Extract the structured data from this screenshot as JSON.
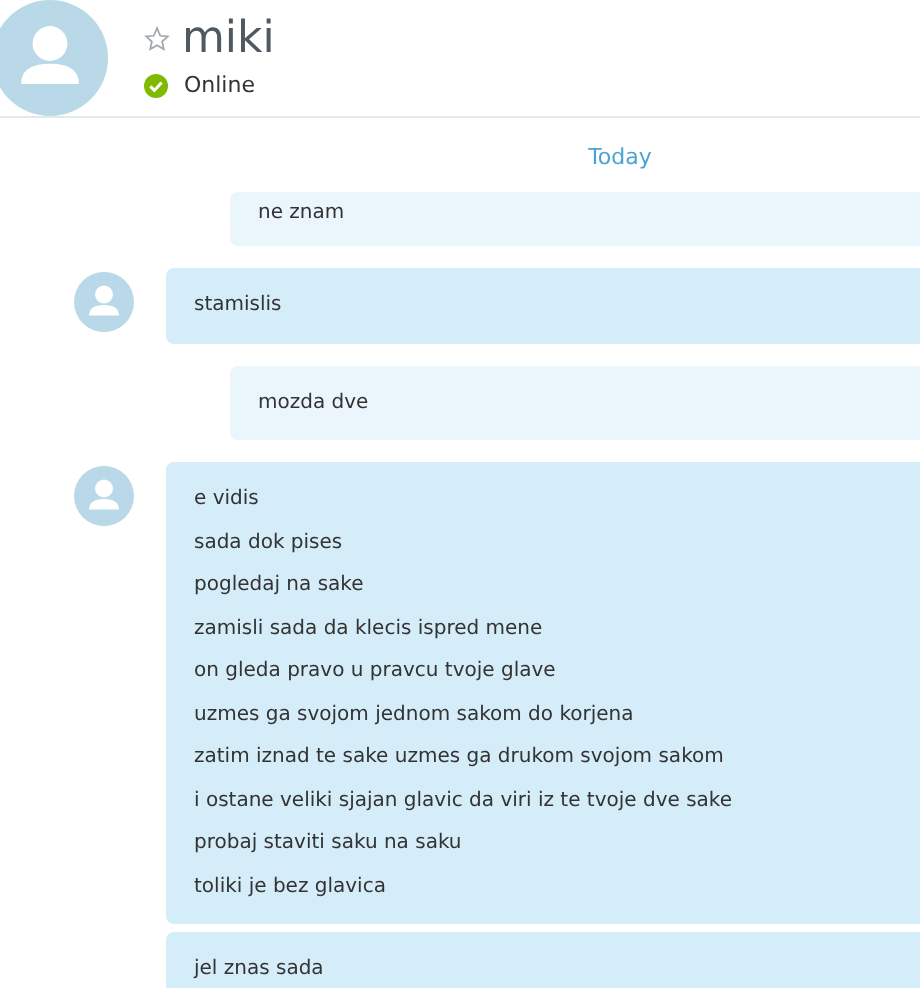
{
  "contact": {
    "name": "miki",
    "favorite": false,
    "status": "Online",
    "online": true
  },
  "day_label": "Today",
  "messages": [
    {
      "kind": "outgoing",
      "avatar": false,
      "lines": [
        "ne znam"
      ]
    },
    {
      "kind": "incoming",
      "avatar": true,
      "lines": [
        "stamislis"
      ]
    },
    {
      "kind": "outgoing",
      "avatar": false,
      "lines": [
        "mozda dve"
      ]
    },
    {
      "kind": "incoming",
      "avatar": true,
      "lines": [
        "e vidis",
        "sada dok pises",
        "pogledaj na sake",
        "zamisli sada da klecis ispred mene",
        "on gleda pravo u pravcu tvoje glave",
        "uzmes ga svojom jednom sakom do korjena",
        "zatim iznad te sake uzmes ga drukom svojom sakom",
        "i ostane veliki sjajan glavic da viri iz te tvoje dve sake",
        "probaj staviti saku na saku",
        "toliki je bez glavica"
      ]
    },
    {
      "kind": "incoming",
      "avatar": false,
      "lines": [
        "jel znas sada"
      ]
    }
  ]
}
